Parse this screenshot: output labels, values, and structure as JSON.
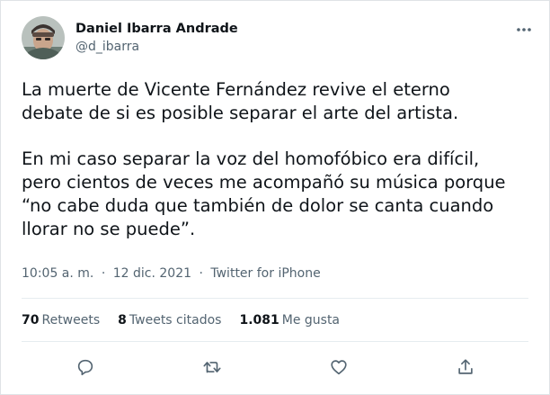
{
  "author": {
    "display_name": "Daniel Ibarra Andrade",
    "handle": "@d_ibarra",
    "avatar_icon": "avatar-photo"
  },
  "more_icon": "more-dots-icon",
  "tweet": {
    "paragraph_1": "La muerte de Vicente Fernández revive el eterno\ndebate de si es posible separar el arte del artista.",
    "paragraph_2": "En mi caso separar la voz del homofóbico era difícil,\npero cientos de veces me acompañó su música porque\n“no cabe duda que también de dolor se canta cuando\nllorar no se puede”."
  },
  "meta": {
    "time": "10:05 a. m.",
    "separator": "·",
    "date": "12 dic. 2021",
    "source": "Twitter for iPhone"
  },
  "stats": {
    "retweets_count": "70",
    "retweets_label": "Retweets",
    "quotes_count": "8",
    "quotes_label": "Tweets citados",
    "likes_count": "1.081",
    "likes_label": "Me gusta"
  },
  "actions": [
    {
      "icon": "reply-icon"
    },
    {
      "icon": "retweet-icon"
    },
    {
      "icon": "like-icon"
    },
    {
      "icon": "share-icon"
    }
  ],
  "colors": {
    "text": "#0f1419",
    "secondary": "#536471",
    "divider": "#e6ecf0"
  }
}
